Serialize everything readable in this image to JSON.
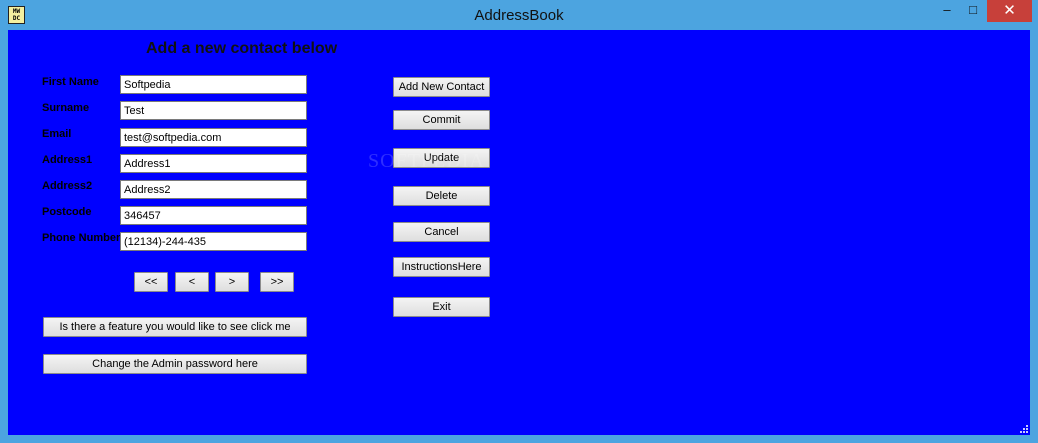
{
  "window": {
    "title": "AddressBook",
    "icon_text": "MW\nDC",
    "min_icon": "minimize-icon",
    "max_icon": "maximize-icon",
    "close_icon": "close-icon",
    "min_glyph": "–",
    "max_glyph": "□",
    "close_glyph": "✕"
  },
  "form": {
    "heading": "Add a new contact below",
    "fields": [
      {
        "label": "First Name",
        "value": "Softpedia"
      },
      {
        "label": "Surname",
        "value": "Test"
      },
      {
        "label": "Email",
        "value": "test@softpedia.com"
      },
      {
        "label": "Address1",
        "value": "Address1"
      },
      {
        "label": "Address2",
        "value": "Address2"
      },
      {
        "label": "Postcode",
        "value": "346457"
      },
      {
        "label": "Phone Number",
        "value": "(12134)-244-435"
      }
    ]
  },
  "nav": {
    "first": "<<",
    "prev": "<",
    "next": ">",
    "last": ">>"
  },
  "actions": {
    "add_new_contact": "Add New Contact",
    "commit": "Commit",
    "update": "Update",
    "delete": "Delete",
    "cancel": "Cancel",
    "instructions": "InstructionsHere",
    "exit": "Exit"
  },
  "bottom": {
    "feature_request": "Is there a feature you would like to see click me",
    "change_password": "Change the Admin password here"
  },
  "watermark": "SOFTPEDIA",
  "colors": {
    "client_background": "#0000ff",
    "titlebar": "#4ca4e0",
    "close_button": "#c7403a"
  }
}
